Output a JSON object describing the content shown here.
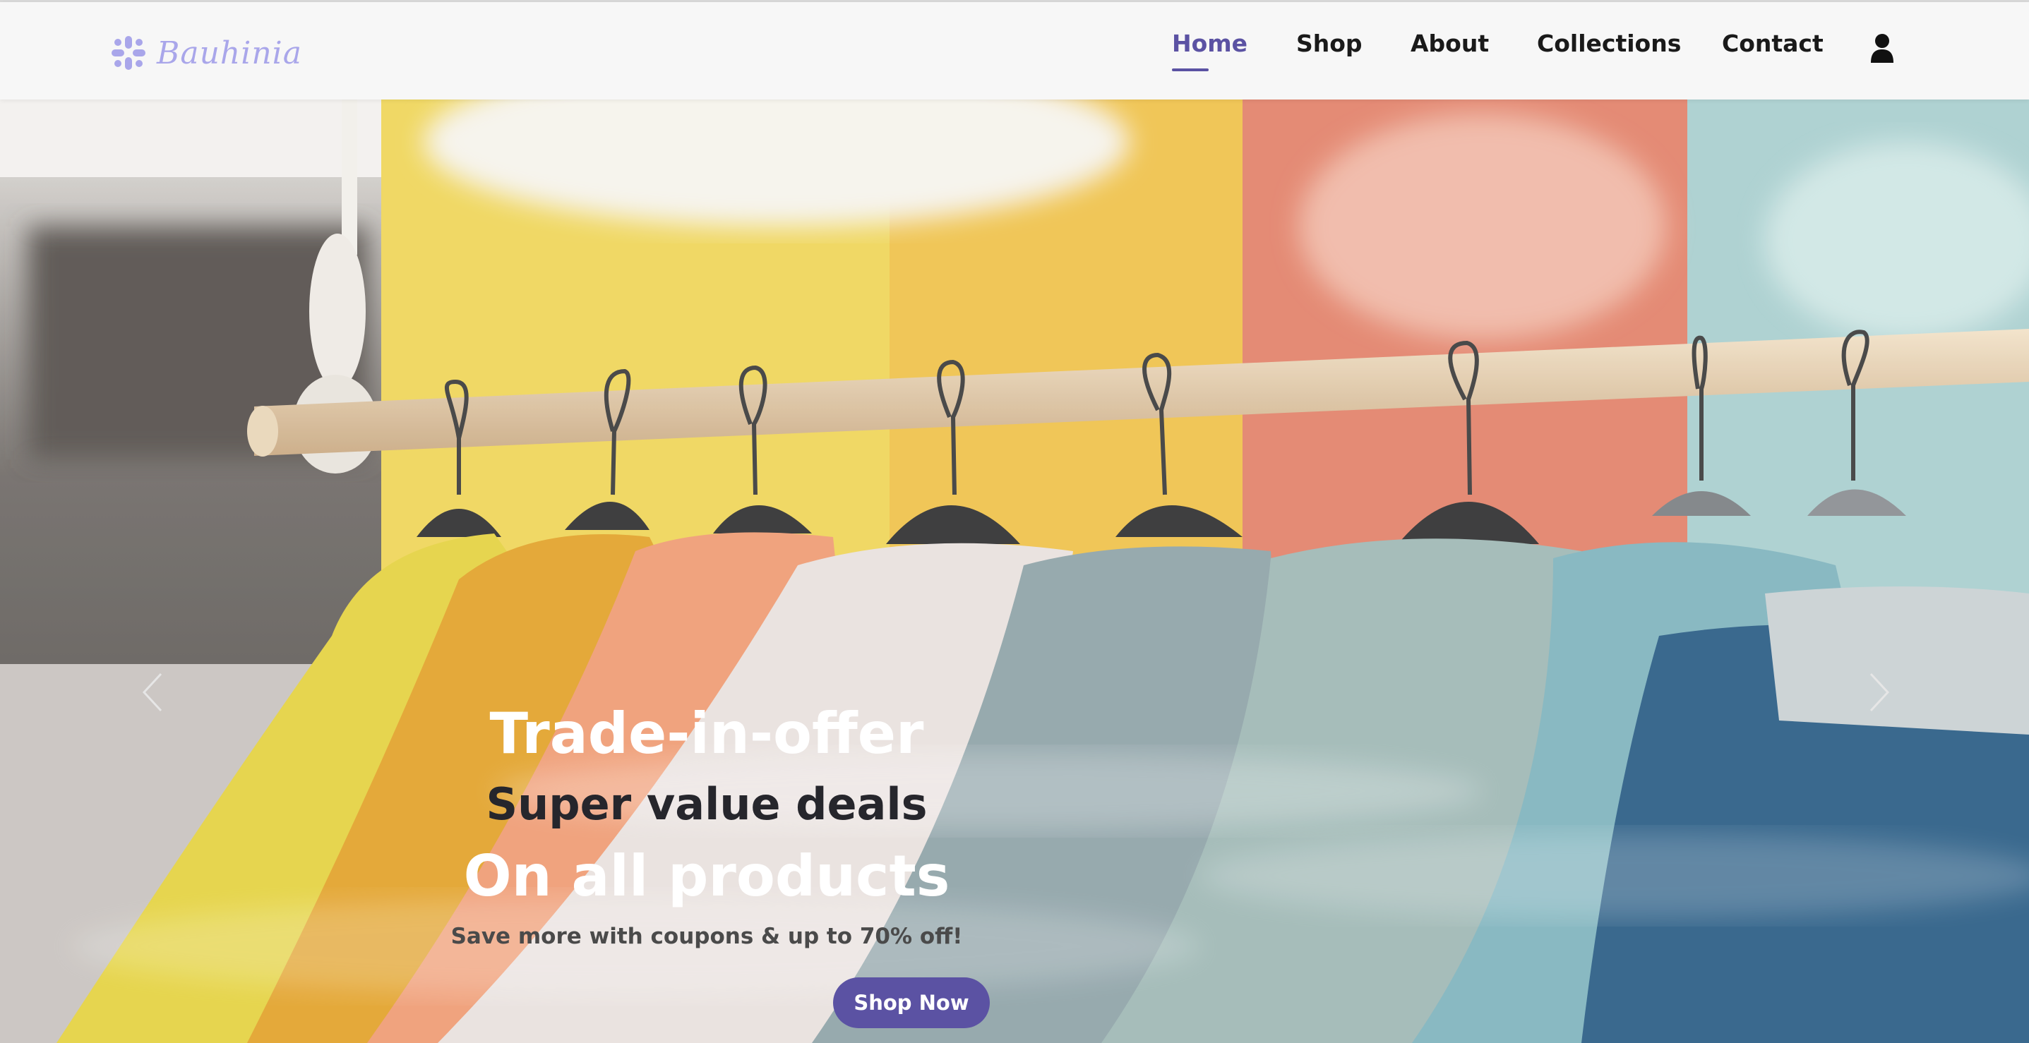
{
  "brand": {
    "name": "Bauhinia",
    "logo_icon": "flower-logo-icon",
    "color": "#a9a6ea"
  },
  "nav": {
    "items": [
      {
        "label": "Home",
        "active": true
      },
      {
        "label": "Shop",
        "active": false
      },
      {
        "label": "About",
        "active": false
      },
      {
        "label": "Collections",
        "active": false
      },
      {
        "label": "Contact",
        "active": false
      }
    ],
    "account_icon": "user-icon",
    "active_color": "#5b52a3"
  },
  "hero": {
    "eyebrow": "Trade-in-offer",
    "headline": "Super value deals",
    "subheadline": "On all products",
    "tagline": "Save more with coupons & up to 70% off!",
    "cta_label": "Shop Now",
    "cta_color": "#5b52a3",
    "prev_icon": "chevron-left-icon",
    "next_icon": "chevron-right-icon"
  }
}
